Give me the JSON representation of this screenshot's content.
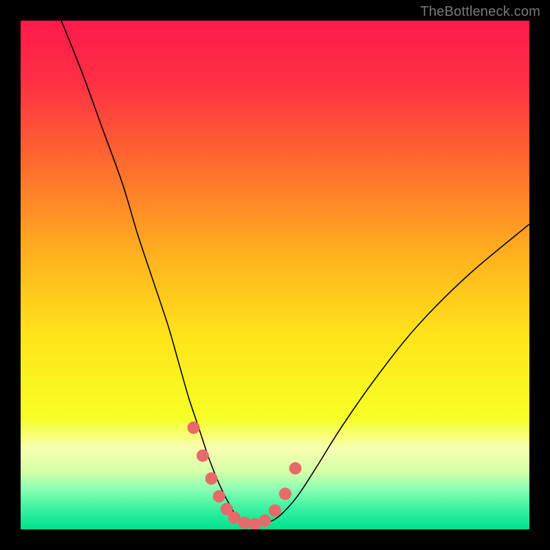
{
  "watermark": "TheBottleneck.com",
  "chart_data": {
    "type": "line",
    "title": "",
    "xlabel": "",
    "ylabel": "",
    "xlim": [
      0,
      100
    ],
    "ylim": [
      0,
      100
    ],
    "grid": false,
    "legend": false,
    "background_gradient": {
      "stops": [
        {
          "offset": 0.0,
          "color": "#ff1a4b"
        },
        {
          "offset": 0.12,
          "color": "#ff2f44"
        },
        {
          "offset": 0.28,
          "color": "#ff6a2f"
        },
        {
          "offset": 0.45,
          "color": "#ffad1f"
        },
        {
          "offset": 0.62,
          "color": "#ffe41a"
        },
        {
          "offset": 0.78,
          "color": "#f7ff26"
        },
        {
          "offset": 0.84,
          "color": "#f7ffb0"
        },
        {
          "offset": 0.885,
          "color": "#d8ffa8"
        },
        {
          "offset": 0.92,
          "color": "#8dffb4"
        },
        {
          "offset": 0.96,
          "color": "#37f2a1"
        },
        {
          "offset": 1.0,
          "color": "#00e08c"
        }
      ]
    },
    "series": [
      {
        "name": "bottleneck-curve",
        "color": "#000000",
        "width": 1.6,
        "x": [
          8,
          12,
          16,
          20,
          23,
          26,
          29,
          31,
          33,
          35,
          37,
          39,
          41,
          43,
          46,
          50,
          54,
          58,
          63,
          70,
          78,
          88,
          100
        ],
        "values": [
          100,
          90,
          79,
          68,
          58,
          49,
          40,
          33,
          26,
          20,
          14,
          9,
          5,
          2,
          1,
          2,
          6,
          12,
          20,
          30,
          40,
          50,
          60
        ]
      },
      {
        "name": "bottleneck-highlight-dots",
        "type": "scatter",
        "color": "#e66a6a",
        "marker_radius": 9,
        "x": [
          34.0,
          35.8,
          37.5,
          39.0,
          40.5,
          42.0,
          44.0,
          46.0,
          48.0,
          50.0,
          52.0,
          54.0
        ],
        "values": [
          20.0,
          14.5,
          10.0,
          6.5,
          4.0,
          2.3,
          1.3,
          1.0,
          1.7,
          3.7,
          7.0,
          12.0
        ]
      }
    ]
  }
}
